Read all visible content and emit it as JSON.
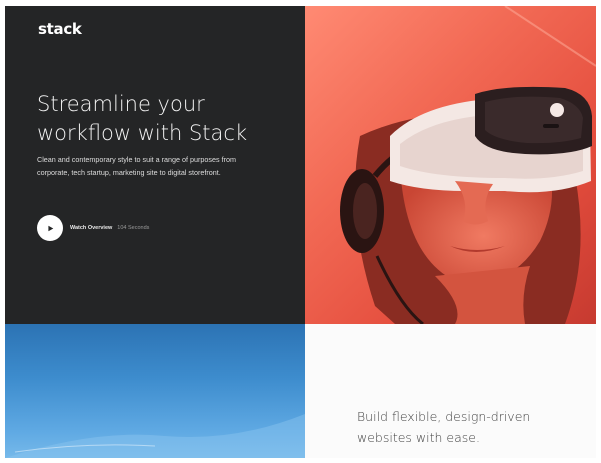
{
  "brand": {
    "logo": "stack"
  },
  "hero": {
    "headline": "Streamline your workflow with Stack",
    "subtext": "Clean and contemporary style to suit a range of purposes from corporate, tech startup, marketing site to digital storefront.",
    "watch_label": "Watch Overview",
    "watch_duration": "104 Seconds",
    "image_description": "vr-headset-photo"
  },
  "sky": {
    "image_description": "blue-sky-photo"
  },
  "feature": {
    "headline": "Build flexible, design-driven websites with ease."
  },
  "colors": {
    "dark_panel": "#242526",
    "accent_coral": "#f26a55",
    "sky_blue": "#3d8ccd"
  }
}
